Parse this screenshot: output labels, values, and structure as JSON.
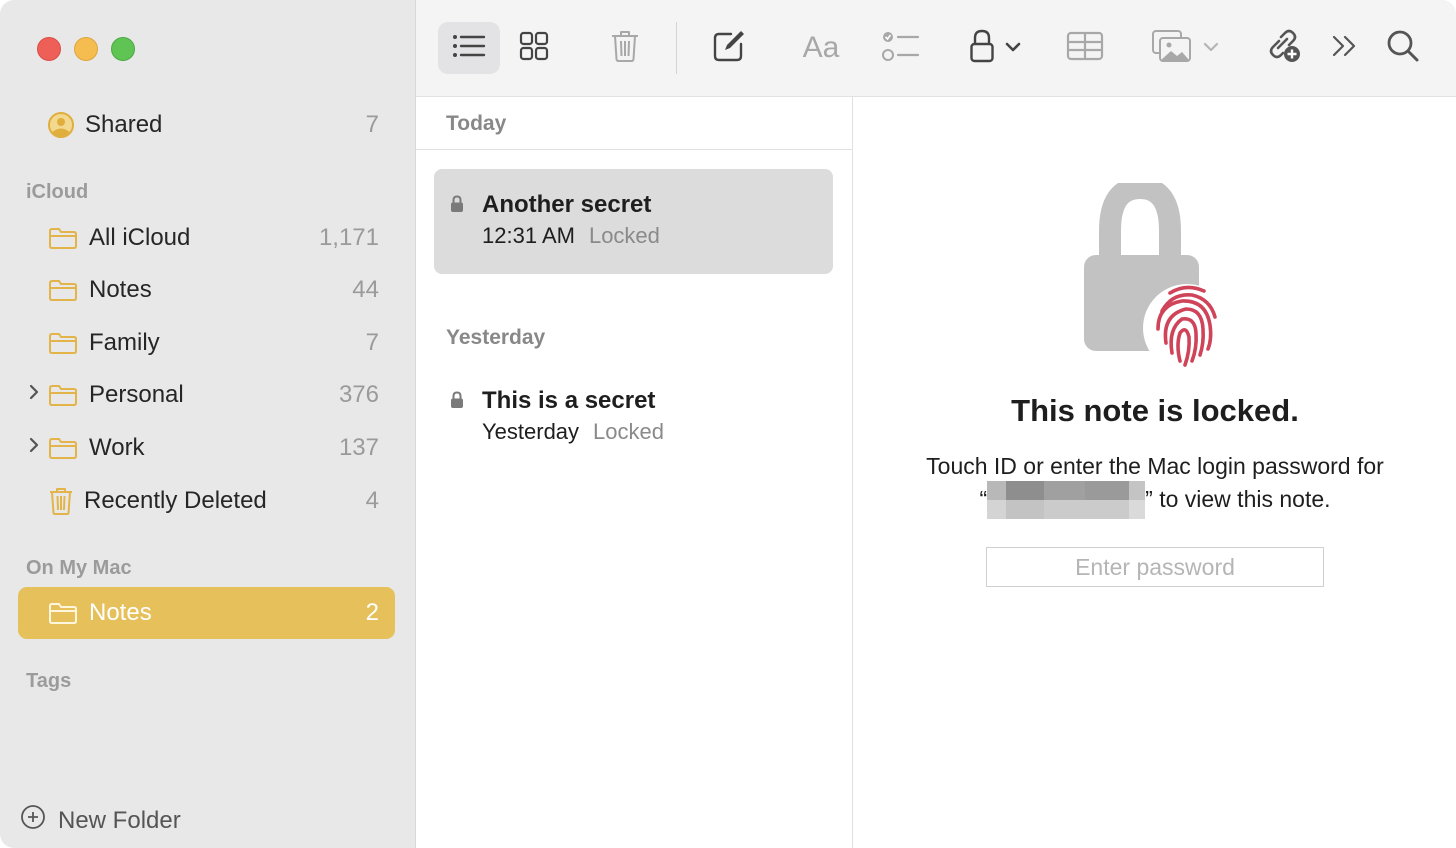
{
  "window": {
    "traffic_lights": [
      "close",
      "minimize",
      "maximize"
    ]
  },
  "sidebar": {
    "shared": {
      "label": "Shared",
      "count": "7",
      "icon": "person-circle-icon"
    },
    "sections": [
      {
        "header": "iCloud",
        "items": [
          {
            "label": "All iCloud",
            "count": "1,171",
            "icon": "folder-icon",
            "expandable": false
          },
          {
            "label": "Notes",
            "count": "44",
            "icon": "folder-icon",
            "expandable": false
          },
          {
            "label": "Family",
            "count": "7",
            "icon": "folder-icon",
            "expandable": false
          },
          {
            "label": "Personal",
            "count": "376",
            "icon": "folder-icon",
            "expandable": true
          },
          {
            "label": "Work",
            "count": "137",
            "icon": "folder-icon",
            "expandable": true
          },
          {
            "label": "Recently Deleted",
            "count": "4",
            "icon": "trash-icon",
            "expandable": false
          }
        ]
      },
      {
        "header": "On My Mac",
        "items": [
          {
            "label": "Notes",
            "count": "2",
            "icon": "folder-icon",
            "selected": true
          }
        ]
      },
      {
        "header": "Tags",
        "items": []
      }
    ],
    "new_folder_label": "New Folder"
  },
  "toolbar": {
    "buttons": [
      {
        "name": "list-view",
        "icon": "list-icon",
        "active": true
      },
      {
        "name": "gallery-view",
        "icon": "grid-icon"
      },
      {
        "name": "delete",
        "icon": "trash-icon",
        "disabled": true
      },
      {
        "name": "new-note",
        "icon": "compose-icon"
      },
      {
        "name": "format",
        "icon": "text-format-icon",
        "label": "Aa",
        "disabled": true
      },
      {
        "name": "checklist",
        "icon": "checklist-icon",
        "disabled": true
      },
      {
        "name": "lock",
        "icon": "lock-icon"
      },
      {
        "name": "table",
        "icon": "table-icon",
        "disabled": true
      },
      {
        "name": "media",
        "icon": "photo-icon",
        "disabled": true
      },
      {
        "name": "collaborate",
        "icon": "link-add-icon"
      },
      {
        "name": "more",
        "icon": "double-chevron-icon"
      },
      {
        "name": "search",
        "icon": "search-icon"
      }
    ]
  },
  "note_list": {
    "groups": [
      {
        "header": "Today",
        "notes": [
          {
            "title": "Another secret",
            "time": "12:31 AM",
            "status": "Locked",
            "selected": true
          }
        ]
      },
      {
        "header": "Yesterday",
        "notes": [
          {
            "title": "This is a secret",
            "time": "Yesterday",
            "status": "Locked",
            "selected": false
          }
        ]
      }
    ]
  },
  "detail": {
    "title": "This note is locked.",
    "description_line1": "Touch ID or enter the Mac login password for",
    "description_open_quote": "“",
    "description_close": "” to view this note.",
    "password_placeholder": "Enter password",
    "password_value": "",
    "colors": {
      "fingerprint": "#d0445a",
      "lock": "#c2c2c2"
    }
  },
  "colors": {
    "accent": "#e6c05a",
    "folder_icon": "#e2b44a",
    "sidebar_bg": "#e8e8e8"
  }
}
